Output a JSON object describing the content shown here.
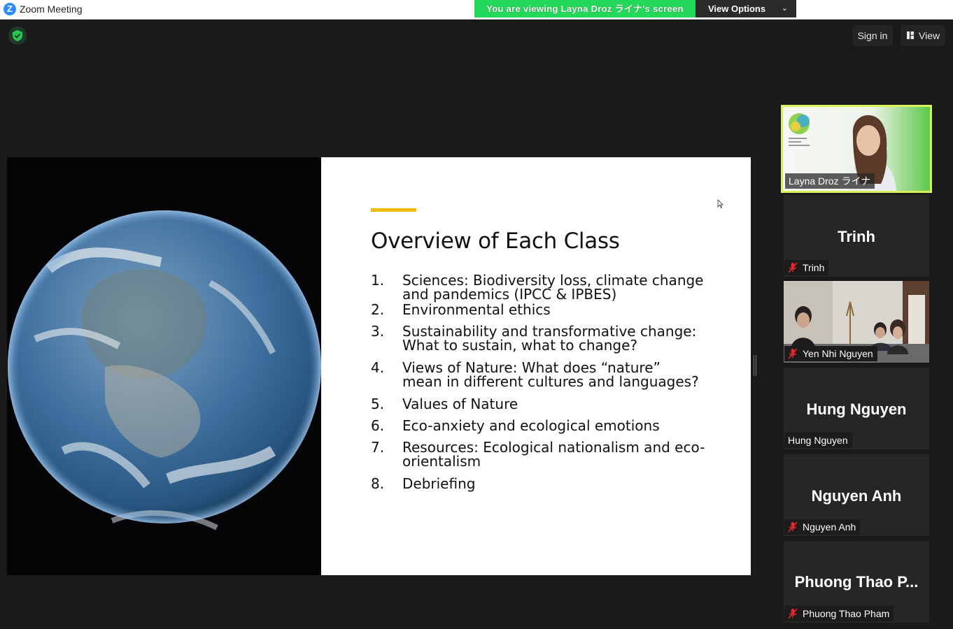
{
  "window": {
    "title": "Zoom Meeting"
  },
  "banner": {
    "viewing_text": "You are viewing Layna Droz ライナ's screen",
    "view_options_label": "View Options"
  },
  "toolbar": {
    "sign_in": "Sign in",
    "view": "View"
  },
  "slide": {
    "title": "Overview of Each Class",
    "items": [
      {
        "num": "1.",
        "line1": "Sciences: Biodiversity loss, climate change",
        "line2": "and pandemics (IPCC & IPBES)"
      },
      {
        "num": "2.",
        "line1": "Environmental ethics",
        "line2": ""
      },
      {
        "num": "3.",
        "line1": "Sustainability and transformative change:",
        "line2": "What to sustain, what to change?"
      },
      {
        "num": "4.",
        "line1": "Views of Nature: What does “nature”",
        "line2": "mean in different cultures and languages?"
      },
      {
        "num": "5.",
        "line1": "Values of Nature",
        "line2": ""
      },
      {
        "num": "6.",
        "line1": "Eco-anxiety and ecological emotions",
        "line2": ""
      },
      {
        "num": "7.",
        "line1": "Resources: Ecological nationalism and eco-",
        "line2": "orientalism"
      },
      {
        "num": "8.",
        "line1": "Debriefing",
        "line2": ""
      }
    ]
  },
  "participants": [
    {
      "name": "Layna Droz ライナ",
      "display": "",
      "muted": false,
      "video": true,
      "speaking": true
    },
    {
      "name": "Trinh",
      "display": "Trinh",
      "muted": true,
      "video": false
    },
    {
      "name": "Yen Nhi Nguyen",
      "display": "",
      "muted": true,
      "video": true
    },
    {
      "name": "Hung Nguyen",
      "display": "Hung Nguyen",
      "muted": false,
      "video": false
    },
    {
      "name": "Nguyen Anh",
      "display": "Nguyen Anh",
      "muted": true,
      "video": false
    },
    {
      "name": "Phuong Thao Pham",
      "display": "Phuong Thao P...",
      "muted": true,
      "video": false
    }
  ],
  "colors": {
    "accent": "#f2b90f",
    "banner": "#23d959",
    "speaker_border": "#d9ef5a",
    "muted_red": "#e02828"
  }
}
